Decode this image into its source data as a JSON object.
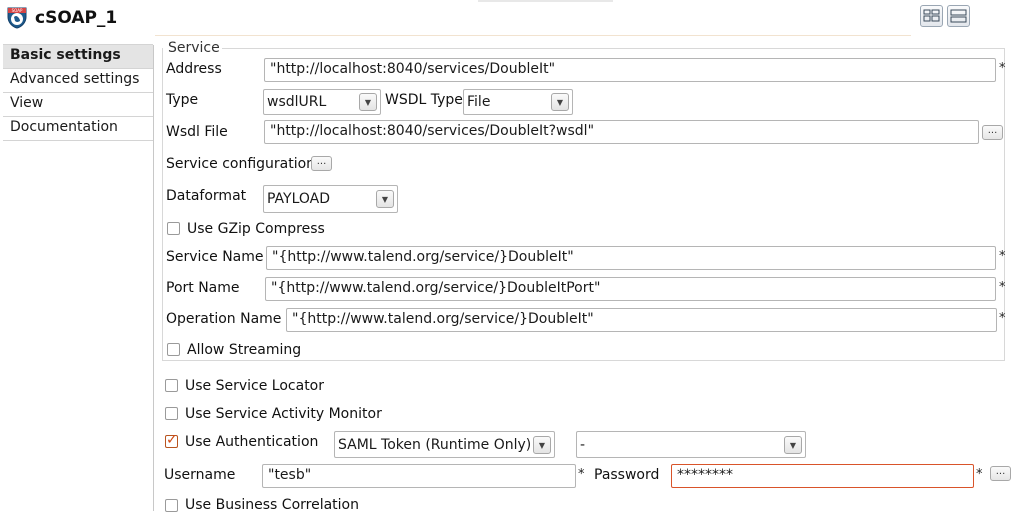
{
  "header": {
    "title": "cSOAP_1",
    "icon": "soap-globe-icon",
    "buttons": [
      "layout-grid-icon",
      "layout-rows-icon"
    ]
  },
  "sidebar": {
    "items": [
      {
        "label": "Basic settings",
        "active": true
      },
      {
        "label": "Advanced settings",
        "active": false
      },
      {
        "label": "View",
        "active": false
      },
      {
        "label": "Documentation",
        "active": false
      }
    ]
  },
  "service": {
    "group_label": "Service",
    "address_label": "Address",
    "address_value": "\"http://localhost:8040/services/DoubleIt\"",
    "type_label": "Type",
    "type_value": "wsdlURL",
    "wsdl_type_label": "WSDL Type",
    "wsdl_type_value": "File",
    "wsdl_file_label": "Wsdl File",
    "wsdl_file_value": "\"http://localhost:8040/services/DoubleIt?wsdl\"",
    "service_config_label": "Service configuration",
    "dataformat_label": "Dataformat",
    "dataformat_value": "PAYLOAD",
    "gzip_label": "Use GZip Compress",
    "service_name_label": "Service Name",
    "service_name_value": "\"{http://www.talend.org/service/}DoubleIt\"",
    "port_name_label": "Port Name",
    "port_name_value": "\"{http://www.talend.org/service/}DoubleItPort\"",
    "operation_name_label": "Operation Name",
    "operation_name_value": "\"{http://www.talend.org/service/}DoubleIt\"",
    "streaming_label": "Allow Streaming",
    "required_mark": "*",
    "dots": "..."
  },
  "options": {
    "service_locator_label": "Use Service Locator",
    "activity_monitor_label": "Use Service Activity Monitor",
    "authentication_label": "Use Authentication",
    "authentication_checked": true,
    "auth_type_value": "SAML Token (Runtime Only)",
    "auth_second_value": "-",
    "username_label": "Username",
    "username_value": "\"tesb\"",
    "password_label": "Password",
    "password_value": "********",
    "business_correlation_label": "Use Business Correlation"
  },
  "colors": {
    "accent": "#d9542a",
    "active_tab_bg": "#e4e4e4"
  }
}
